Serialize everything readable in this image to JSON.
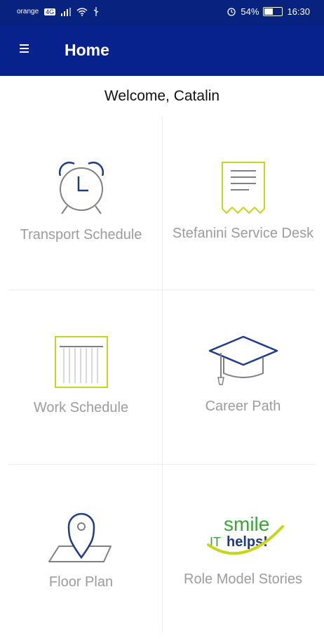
{
  "status_bar": {
    "carrier": "orange",
    "network_badge": "4G",
    "battery_percent": "54%",
    "battery_level": 0.54,
    "time": "16:30",
    "icons": [
      "signal-icon",
      "wifi-icon",
      "usb-icon",
      "alarm-icon",
      "battery-icon"
    ]
  },
  "app_bar": {
    "title": "Home",
    "menu_icon": "hamburger-menu-icon",
    "background_color": "#07228d"
  },
  "welcome": {
    "text": "Welcome,  Catalin"
  },
  "tiles": [
    {
      "label": "Transport Schedule",
      "icon": "alarm-clock-icon"
    },
    {
      "label": "Stefanini Service Desk",
      "icon": "receipt-icon"
    },
    {
      "label": "Work Schedule",
      "icon": "calendar-grid-icon"
    },
    {
      "label": "Career Path",
      "icon": "graduation-cap-icon"
    },
    {
      "label": "Floor Plan",
      "icon": "map-pin-icon"
    },
    {
      "label": "Role Model Stories",
      "icon": "it-helps-logo"
    }
  ],
  "logo": {
    "line1": "smile",
    "line2_prefix": "IT",
    "line2": "helps!"
  },
  "colors": {
    "primary": "#07228d",
    "icon_blue": "#1f3a8a",
    "icon_grey": "#808080",
    "accent_yellow": "#c8d51a",
    "logo_green": "#3aa536",
    "label_grey": "#9c9c9c"
  }
}
